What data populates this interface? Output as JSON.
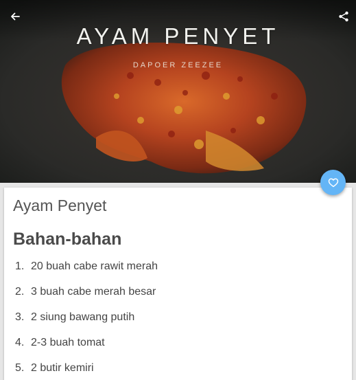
{
  "header": {
    "back_icon": "arrow-left-icon",
    "share_icon": "share-icon"
  },
  "hero": {
    "title": "AYAM PENYET",
    "watermark": "DAPOER ZEEZEE"
  },
  "fab": {
    "icon": "heart-outline-icon",
    "color": "#64b5f6"
  },
  "recipe": {
    "name": "Ayam Penyet",
    "section_title": "Bahan-bahan",
    "ingredients": [
      {
        "num": "1.",
        "text": "20 buah cabe rawit merah"
      },
      {
        "num": "2.",
        "text": "3 buah cabe merah besar"
      },
      {
        "num": "3.",
        "text": "2 siung bawang putih"
      },
      {
        "num": "4.",
        "text": "2-3 buah tomat"
      },
      {
        "num": "5.",
        "text": "2 butir kemiri"
      }
    ]
  }
}
